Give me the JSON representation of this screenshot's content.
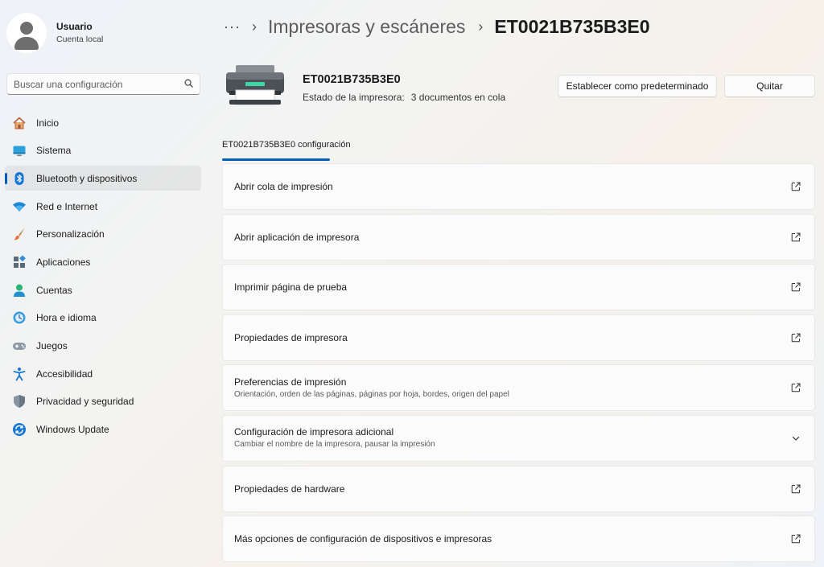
{
  "user": {
    "name": "Usuario",
    "account": "Cuenta local"
  },
  "search": {
    "placeholder": "Buscar una configuración"
  },
  "sidebar": {
    "items": [
      {
        "label": "Inicio",
        "icon": "home-icon"
      },
      {
        "label": "Sistema",
        "icon": "system-icon"
      },
      {
        "label": "Bluetooth y dispositivos",
        "icon": "bluetooth-icon",
        "active": true
      },
      {
        "label": "Red e Internet",
        "icon": "wifi-icon"
      },
      {
        "label": "Personalización",
        "icon": "brush-icon"
      },
      {
        "label": "Aplicaciones",
        "icon": "apps-icon"
      },
      {
        "label": "Cuentas",
        "icon": "accounts-icon"
      },
      {
        "label": "Hora e idioma",
        "icon": "time-language-icon"
      },
      {
        "label": "Juegos",
        "icon": "gamepad-icon"
      },
      {
        "label": "Accesibilidad",
        "icon": "accessibility-icon"
      },
      {
        "label": "Privacidad y seguridad",
        "icon": "shield-icon"
      },
      {
        "label": "Windows Update",
        "icon": "update-icon"
      }
    ]
  },
  "breadcrumb": {
    "more": "···",
    "parent": "Impresoras y escáneres",
    "current": "ET0021B735B3E0"
  },
  "printer": {
    "name": "ET0021B735B3E0",
    "status_label": "Estado de la impresora:",
    "status_value": "3 documentos en cola"
  },
  "actions": {
    "set_default": "Establecer como predeterminado",
    "remove": "Quitar"
  },
  "tab": {
    "label": "ET0021B735B3E0 configuración"
  },
  "cards": [
    {
      "title": "Abrir cola de impresión",
      "subtitle": "",
      "icon": "open-external-icon"
    },
    {
      "title": "Abrir aplicación de impresora",
      "subtitle": "",
      "icon": "open-external-icon"
    },
    {
      "title": "Imprimir página de prueba",
      "subtitle": "",
      "icon": "open-external-icon"
    },
    {
      "title": "Propiedades de impresora",
      "subtitle": "",
      "icon": "open-external-icon"
    },
    {
      "title": "Preferencias de impresión",
      "subtitle": "Orientación, orden de las páginas, páginas por hoja, bordes, origen del papel",
      "icon": "open-external-icon"
    },
    {
      "title": "Configuración de impresora adicional",
      "subtitle": "Cambiar el nombre de la impresora, pausar la impresión",
      "icon": "chevron-down-icon"
    },
    {
      "title": "Propiedades de hardware",
      "subtitle": "",
      "icon": "open-external-icon"
    },
    {
      "title": "Más opciones de configuración de dispositivos e impresoras",
      "subtitle": "",
      "icon": "open-external-icon"
    }
  ],
  "colors": {
    "accent": "#005fb8",
    "background": "#f3f3f3",
    "card": "#fbfbfb"
  }
}
